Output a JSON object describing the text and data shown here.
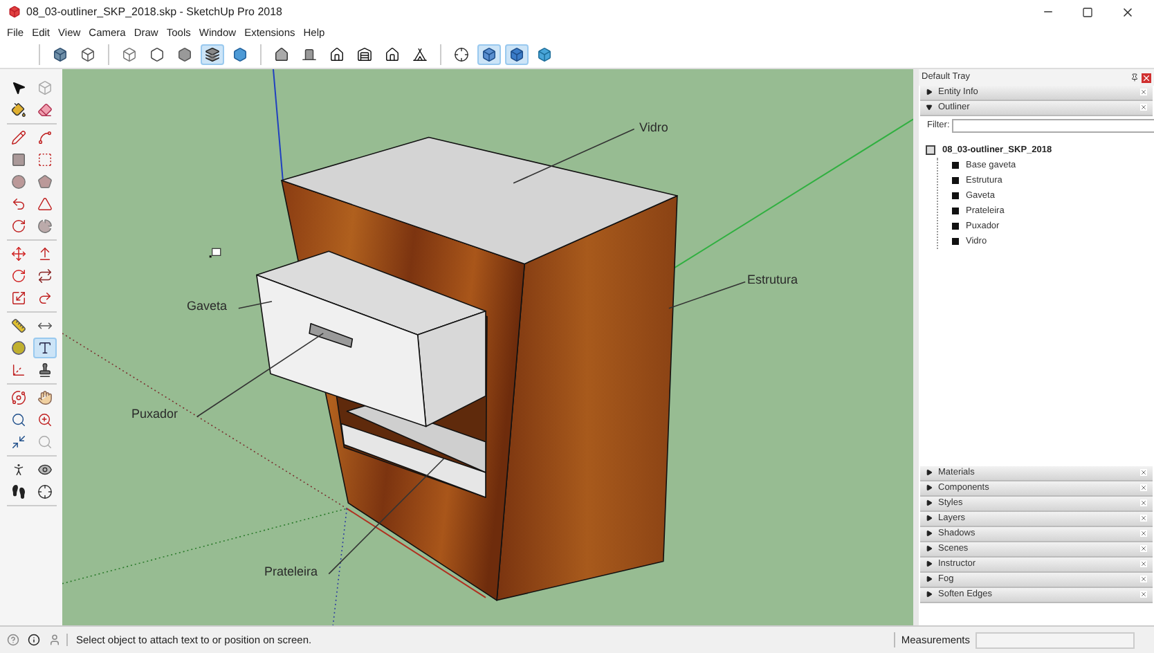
{
  "window": {
    "title": "08_03-outliner_SKP_2018.skp - SketchUp Pro 2018"
  },
  "menu": [
    "File",
    "Edit",
    "View",
    "Camera",
    "Draw",
    "Tools",
    "Window",
    "Extensions",
    "Help"
  ],
  "toolbar": {
    "groups": [
      {
        "items": [
          {
            "kind": "solid-cube",
            "selected": false
          },
          {
            "kind": "outline-cube",
            "selected": false
          }
        ]
      },
      {
        "items": [
          {
            "kind": "xray-cube",
            "selected": false
          },
          {
            "kind": "hexagon",
            "selected": false
          },
          {
            "kind": "gray-hexagon",
            "selected": false
          },
          {
            "kind": "layers",
            "selected": true
          },
          {
            "kind": "blue-hexagon",
            "selected": false
          }
        ]
      },
      {
        "items": [
          {
            "kind": "iso-house",
            "selected": false
          },
          {
            "kind": "door",
            "selected": false
          },
          {
            "kind": "house",
            "selected": false
          },
          {
            "kind": "warehouse",
            "selected": false
          },
          {
            "kind": "house-outline",
            "selected": false
          },
          {
            "kind": "house-back",
            "selected": false
          }
        ]
      },
      {
        "items": [
          {
            "kind": "crosshair",
            "selected": false
          },
          {
            "kind": "blue-box",
            "selected": true
          },
          {
            "kind": "blue-cube",
            "selected": true
          },
          {
            "kind": "small-cube",
            "selected": false
          }
        ]
      }
    ]
  },
  "tool_palette": {
    "groups": [
      {
        "items": [
          {
            "kind": "pointer",
            "selected": false
          },
          {
            "kind": "gray-cube",
            "selected": false
          },
          {
            "kind": "bucket",
            "selected": false
          },
          {
            "kind": "eraser",
            "selected": false
          }
        ]
      },
      {
        "items": [
          {
            "kind": "pencil",
            "selected": false
          },
          {
            "kind": "curve",
            "selected": false
          },
          {
            "kind": "square",
            "selected": false
          },
          {
            "kind": "dashed-square",
            "selected": false
          },
          {
            "kind": "circle",
            "selected": false
          },
          {
            "kind": "pentagon",
            "selected": false
          },
          {
            "kind": "arc",
            "selected": false
          },
          {
            "kind": "triangle",
            "selected": false
          },
          {
            "kind": "undo-arc",
            "selected": false
          },
          {
            "kind": "pie",
            "selected": false
          }
        ]
      },
      {
        "items": [
          {
            "kind": "move",
            "selected": false
          },
          {
            "kind": "push",
            "selected": false
          },
          {
            "kind": "rotate",
            "selected": false
          },
          {
            "kind": "repeat",
            "selected": false
          },
          {
            "kind": "scale",
            "selected": false
          },
          {
            "kind": "redo-arc",
            "selected": false
          }
        ]
      },
      {
        "items": [
          {
            "kind": "ruler",
            "selected": false
          },
          {
            "kind": "dimension",
            "selected": false
          },
          {
            "kind": "compass",
            "selected": false
          },
          {
            "kind": "text",
            "selected": true
          },
          {
            "kind": "axes",
            "selected": false
          },
          {
            "kind": "stamp",
            "selected": false
          }
        ]
      },
      {
        "items": [
          {
            "kind": "orbit",
            "selected": false
          },
          {
            "kind": "hand",
            "selected": false
          },
          {
            "kind": "zoom",
            "selected": false
          },
          {
            "kind": "zoom-window",
            "selected": false
          },
          {
            "kind": "extents",
            "selected": false
          },
          {
            "kind": "gray-zoom",
            "selected": false
          }
        ]
      },
      {
        "items": [
          {
            "kind": "person",
            "selected": false
          },
          {
            "kind": "eye",
            "selected": false
          },
          {
            "kind": "footprints",
            "selected": false
          },
          {
            "kind": "crosshair",
            "selected": false
          }
        ]
      }
    ]
  },
  "canvas": {
    "labels": [
      {
        "text": "Vidro"
      },
      {
        "text": "Estrutura"
      },
      {
        "text": "Gaveta"
      },
      {
        "text": "Puxador"
      },
      {
        "text": "Prateleira"
      }
    ]
  },
  "tray": {
    "title": "Default Tray",
    "panels": [
      {
        "title": "Entity Info",
        "expanded": false
      },
      {
        "title": "Outliner",
        "expanded": true,
        "filter": {
          "label": "Filter:"
        },
        "tree": [
          {
            "label": "08_03-outliner_SKP_2018",
            "children": [
              {
                "label": "Base gaveta"
              },
              {
                "label": "Estrutura"
              },
              {
                "label": "Gaveta"
              },
              {
                "label": "Prateleira"
              },
              {
                "label": "Puxador"
              },
              {
                "label": "Vidro"
              }
            ]
          }
        ]
      },
      {
        "title": "Materials",
        "expanded": false
      },
      {
        "title": "Components",
        "expanded": false
      },
      {
        "title": "Styles",
        "expanded": false
      },
      {
        "title": "Layers",
        "expanded": false
      },
      {
        "title": "Shadows",
        "expanded": false
      },
      {
        "title": "Scenes",
        "expanded": false
      },
      {
        "title": "Instructor",
        "expanded": false
      },
      {
        "title": "Fog",
        "expanded": false
      },
      {
        "title": "Soften Edges",
        "expanded": false
      }
    ]
  },
  "status_bar": {
    "message": "Select object to attach text to or position on screen.",
    "measurements_label": "Measurements"
  }
}
